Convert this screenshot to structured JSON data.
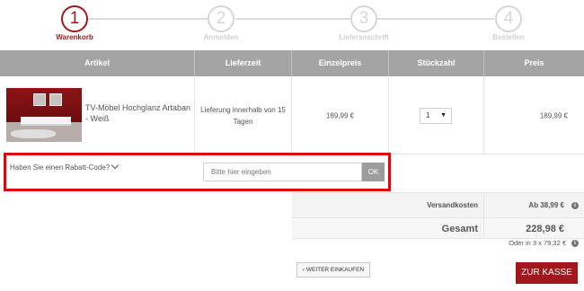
{
  "steps": [
    {
      "num": "1",
      "label": "Warenkorb",
      "active": true
    },
    {
      "num": "2",
      "label": "Anmelden",
      "active": false
    },
    {
      "num": "3",
      "label": "Lieferanschrift",
      "active": false
    },
    {
      "num": "4",
      "label": "Bestellen",
      "active": false
    }
  ],
  "table": {
    "headers": [
      "Artikel",
      "Lieferzeit",
      "Einzelpreis",
      "Stückzahl",
      "Preis"
    ]
  },
  "item": {
    "name": "TV-Möbel Hochglanz Artaban - Weiß",
    "delivery": "Lieferung innerhalb von 15 Tagen",
    "unit_price": "189,99 €",
    "quantity": "1",
    "price": "189,99 €"
  },
  "coupon": {
    "label": "Haben Sie einen Rabatt-Code?",
    "placeholder": "Bitte hier eingeben",
    "ok_label": "OK"
  },
  "totals": {
    "shipping_label": "Versandkosten",
    "shipping_value": "Ab 38,99 €",
    "total_label": "Gesamt",
    "total_value": "228,98 €",
    "installment": "Oder in 3 x 79,32 €"
  },
  "buttons": {
    "continue_label": "WEITER EINKAUFEN",
    "checkout_label": "ZUR KASSE"
  },
  "colors": {
    "accent": "#9b1b1b",
    "highlight_border": "#e2050c",
    "header_bg": "#a4a4a4"
  },
  "icons": [
    "chevron-down-icon",
    "info-icon",
    "chevron-left-icon",
    "caret-down-icon"
  ]
}
